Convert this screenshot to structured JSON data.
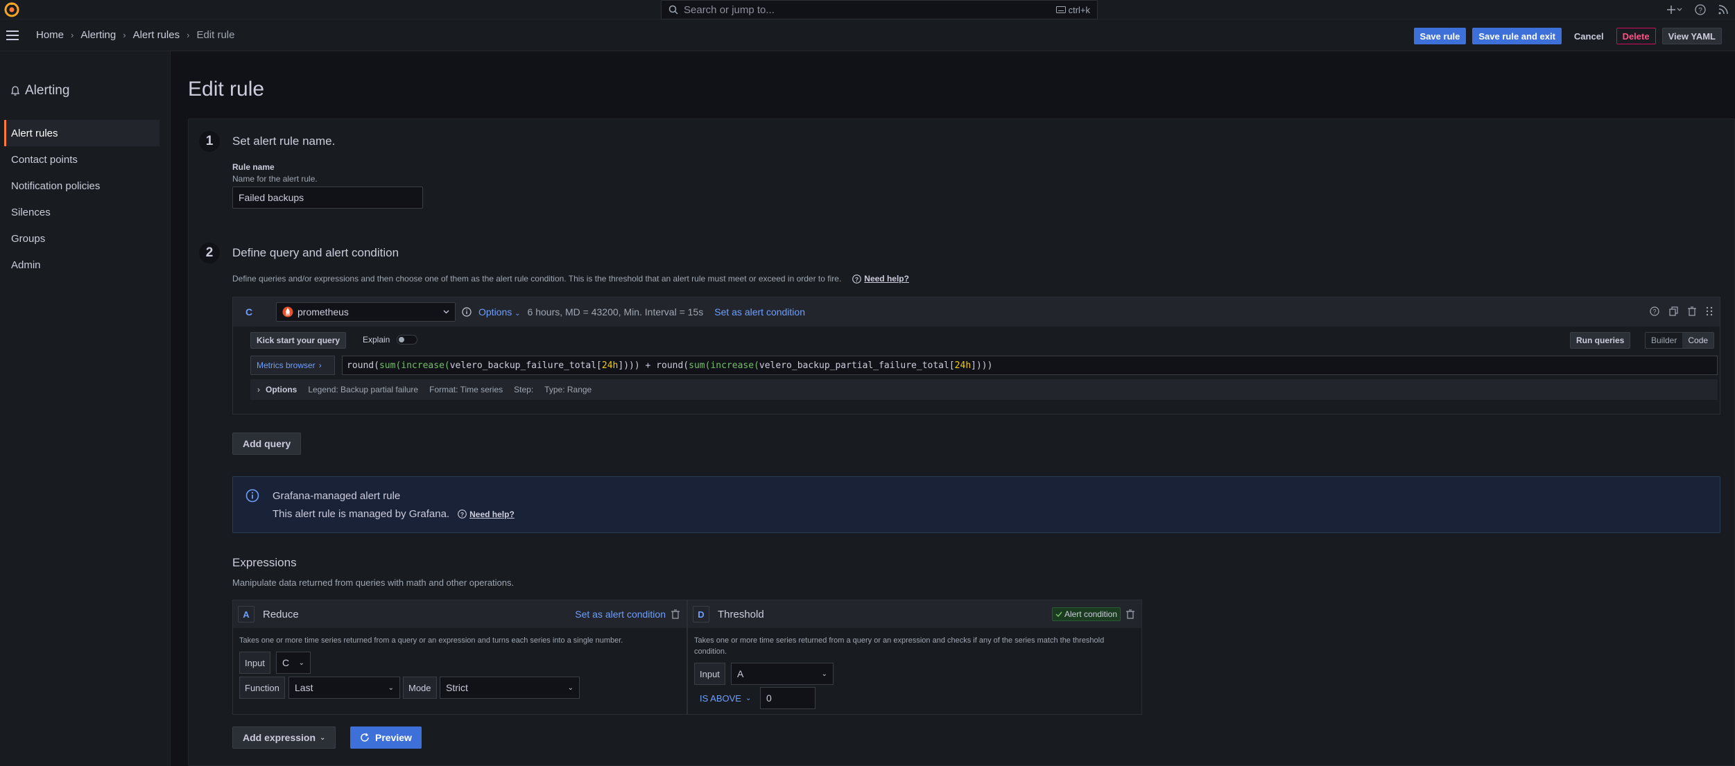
{
  "topbar": {
    "search_placeholder": "Search or jump to...",
    "search_shortcut": "ctrl+k"
  },
  "breadcrumb": [
    "Home",
    "Alerting",
    "Alert rules",
    "Edit rule"
  ],
  "actions": {
    "save": "Save rule",
    "save_exit": "Save rule and exit",
    "cancel": "Cancel",
    "delete": "Delete",
    "view_yaml": "View YAML"
  },
  "sidebar": {
    "title": "Alerting",
    "items": [
      {
        "label": "Alert rules",
        "active": true
      },
      {
        "label": "Contact points"
      },
      {
        "label": "Notification policies"
      },
      {
        "label": "Silences"
      },
      {
        "label": "Groups"
      },
      {
        "label": "Admin"
      }
    ]
  },
  "page": {
    "title": "Edit rule"
  },
  "step1": {
    "num": "1",
    "title": "Set alert rule name.",
    "label": "Rule name",
    "desc": "Name for the alert rule.",
    "value": "Failed backups"
  },
  "step2": {
    "num": "2",
    "title": "Define query and alert condition",
    "desc": "Define queries and/or expressions and then choose one of them as the alert rule condition. This is the threshold that an alert rule must meet or exceed in order to fire.",
    "help": "Need help?"
  },
  "query": {
    "ref": "C",
    "datasource": "prometheus",
    "options_label": "Options",
    "options_summary": "6 hours, MD = 43200, Min. Interval = 15s",
    "set_condition": "Set as alert condition",
    "kickstart": "Kick start your query",
    "explain": "Explain",
    "run": "Run queries",
    "mode_builder": "Builder",
    "mode_code": "Code",
    "metrics_browser": "Metrics browser",
    "expr_parts": {
      "p1": "round(",
      "p2": "sum(",
      "p3": "increase(",
      "p4": "velero_backup_failure_total[",
      "p5": "24h",
      "p6": "])))",
      "plus": " + ",
      "q1": "round(",
      "q2": "sum(",
      "q3": "increase(",
      "q4": "velero_backup_partial_failure_total[",
      "q5": "24h",
      "q6": "])))"
    },
    "opt_label": "Options",
    "legend": "Legend: Backup partial failure",
    "format": "Format: Time series",
    "step": "Step:",
    "type": "Type: Range"
  },
  "add_query": "Add query",
  "info": {
    "title": "Grafana-managed alert rule",
    "body": "This alert rule is managed by Grafana.",
    "help": "Need help?"
  },
  "expressions": {
    "title": "Expressions",
    "desc": "Manipulate data returned from queries with math and other operations.",
    "reduce": {
      "ref": "A",
      "name": "Reduce",
      "set_condition": "Set as alert condition",
      "desc": "Takes one or more time series returned from a query or an expression and turns each series into a single number.",
      "input_label": "Input",
      "input_value": "C",
      "function_label": "Function",
      "function_value": "Last",
      "mode_label": "Mode",
      "mode_value": "Strict"
    },
    "threshold": {
      "ref": "D",
      "name": "Threshold",
      "badge": "Alert condition",
      "desc": "Takes one or more time series returned from a query or an expression and checks if any of the series match the threshold condition.",
      "input_label": "Input",
      "input_value": "A",
      "operator": "IS ABOVE",
      "value": "0"
    }
  },
  "add_expression": "Add expression",
  "preview": "Preview",
  "colors": {
    "primary": "#3d71d9",
    "accent_orange": "#ff7a34",
    "link_blue": "#6e9fff",
    "success": "#73bf69",
    "danger": "#ff5286"
  }
}
